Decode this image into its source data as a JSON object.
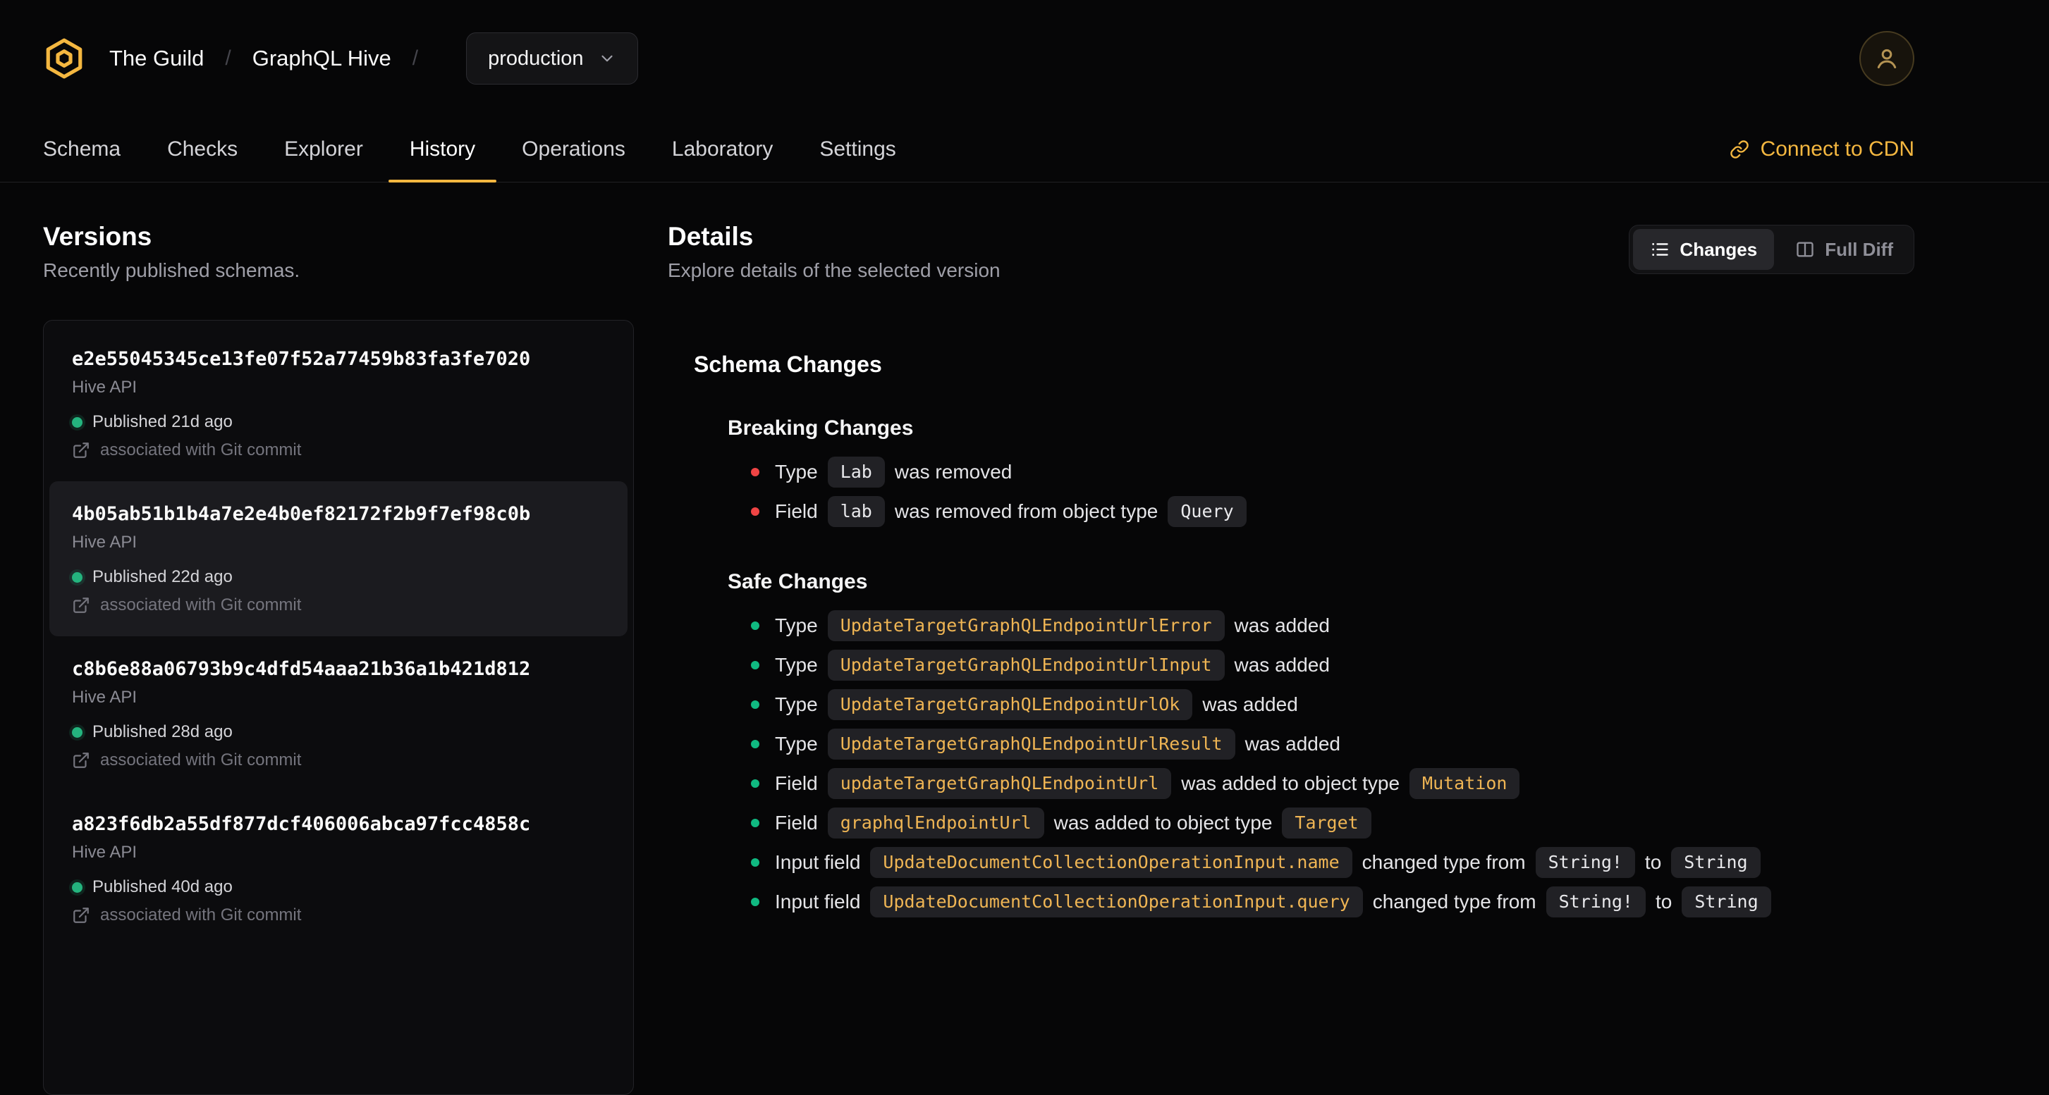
{
  "colors": {
    "accent": "#f4b740",
    "breaking": "#ef4444",
    "safe": "#10b981",
    "published_dot": "#24b47e"
  },
  "icons": {
    "logo": "hive-honeycomb",
    "target_chevron": "chevron-down",
    "avatar": "user",
    "cdn": "link",
    "commit": "external-link",
    "changes_view": "list",
    "full_diff_view": "columns",
    "published": "status-dot"
  },
  "header": {
    "org": "The Guild",
    "separator": "/",
    "project": "GraphQL Hive",
    "target": "production"
  },
  "nav": {
    "tabs": [
      {
        "label": "Schema",
        "active": false
      },
      {
        "label": "Checks",
        "active": false
      },
      {
        "label": "Explorer",
        "active": false
      },
      {
        "label": "History",
        "active": true
      },
      {
        "label": "Operations",
        "active": false
      },
      {
        "label": "Laboratory",
        "active": false
      },
      {
        "label": "Settings",
        "active": false
      }
    ],
    "cdn_link": "Connect to CDN"
  },
  "versions": {
    "title": "Versions",
    "subtitle": "Recently published schemas.",
    "items": [
      {
        "hash": "e2e55045345ce13fe07f52a77459b83fa3fe7020",
        "service": "Hive API",
        "published": "Published 21d ago",
        "commit": "associated with Git commit",
        "selected": false
      },
      {
        "hash": "4b05ab51b1b4a7e2e4b0ef82172f2b9f7ef98c0b",
        "service": "Hive API",
        "published": "Published 22d ago",
        "commit": "associated with Git commit",
        "selected": true
      },
      {
        "hash": "c8b6e88a06793b9c4dfd54aaa21b36a1b421d812",
        "service": "Hive API",
        "published": "Published 28d ago",
        "commit": "associated with Git commit",
        "selected": false
      },
      {
        "hash": "a823f6db2a55df877dcf406006abca97fcc4858c",
        "service": "Hive API",
        "published": "Published 40d ago",
        "commit": "associated with Git commit",
        "selected": false
      }
    ]
  },
  "details": {
    "title": "Details",
    "subtitle": "Explore details of the selected version",
    "view_toggle": [
      {
        "label": "Changes",
        "active": true
      },
      {
        "label": "Full Diff",
        "active": false
      }
    ],
    "schema_changes_title": "Schema Changes",
    "sections": [
      {
        "title": "Breaking Changes",
        "bullet_color": "#ef4444",
        "items": [
          [
            {
              "text": "Type"
            },
            {
              "code": "Lab",
              "tone": "light"
            },
            {
              "text": "was removed"
            }
          ],
          [
            {
              "text": "Field"
            },
            {
              "code": "lab",
              "tone": "light"
            },
            {
              "text": "was removed from object type"
            },
            {
              "code": "Query",
              "tone": "light"
            }
          ]
        ]
      },
      {
        "title": "Safe Changes",
        "bullet_color": "#10b981",
        "items": [
          [
            {
              "text": "Type"
            },
            {
              "code": "UpdateTargetGraphQLEndpointUrlError",
              "tone": "amber"
            },
            {
              "text": "was added"
            }
          ],
          [
            {
              "text": "Type"
            },
            {
              "code": "UpdateTargetGraphQLEndpointUrlInput",
              "tone": "amber"
            },
            {
              "text": "was added"
            }
          ],
          [
            {
              "text": "Type"
            },
            {
              "code": "UpdateTargetGraphQLEndpointUrlOk",
              "tone": "amber"
            },
            {
              "text": "was added"
            }
          ],
          [
            {
              "text": "Type"
            },
            {
              "code": "UpdateTargetGraphQLEndpointUrlResult",
              "tone": "amber"
            },
            {
              "text": "was added"
            }
          ],
          [
            {
              "text": "Field"
            },
            {
              "code": "updateTargetGraphQLEndpointUrl",
              "tone": "amber"
            },
            {
              "text": "was added to object type"
            },
            {
              "code": "Mutation",
              "tone": "amber"
            }
          ],
          [
            {
              "text": "Field"
            },
            {
              "code": "graphqlEndpointUrl",
              "tone": "amber"
            },
            {
              "text": "was added to object type"
            },
            {
              "code": "Target",
              "tone": "amber"
            }
          ],
          [
            {
              "text": "Input field"
            },
            {
              "code": "UpdateDocumentCollectionOperationInput.name",
              "tone": "amber"
            },
            {
              "text": "changed type from"
            },
            {
              "code": "String!",
              "tone": "light"
            },
            {
              "text": "to"
            },
            {
              "code": "String",
              "tone": "light"
            }
          ],
          [
            {
              "text": "Input field"
            },
            {
              "code": "UpdateDocumentCollectionOperationInput.query",
              "tone": "amber"
            },
            {
              "text": "changed type from"
            },
            {
              "code": "String!",
              "tone": "light"
            },
            {
              "text": "to"
            },
            {
              "code": "String",
              "tone": "light"
            }
          ]
        ]
      }
    ]
  }
}
